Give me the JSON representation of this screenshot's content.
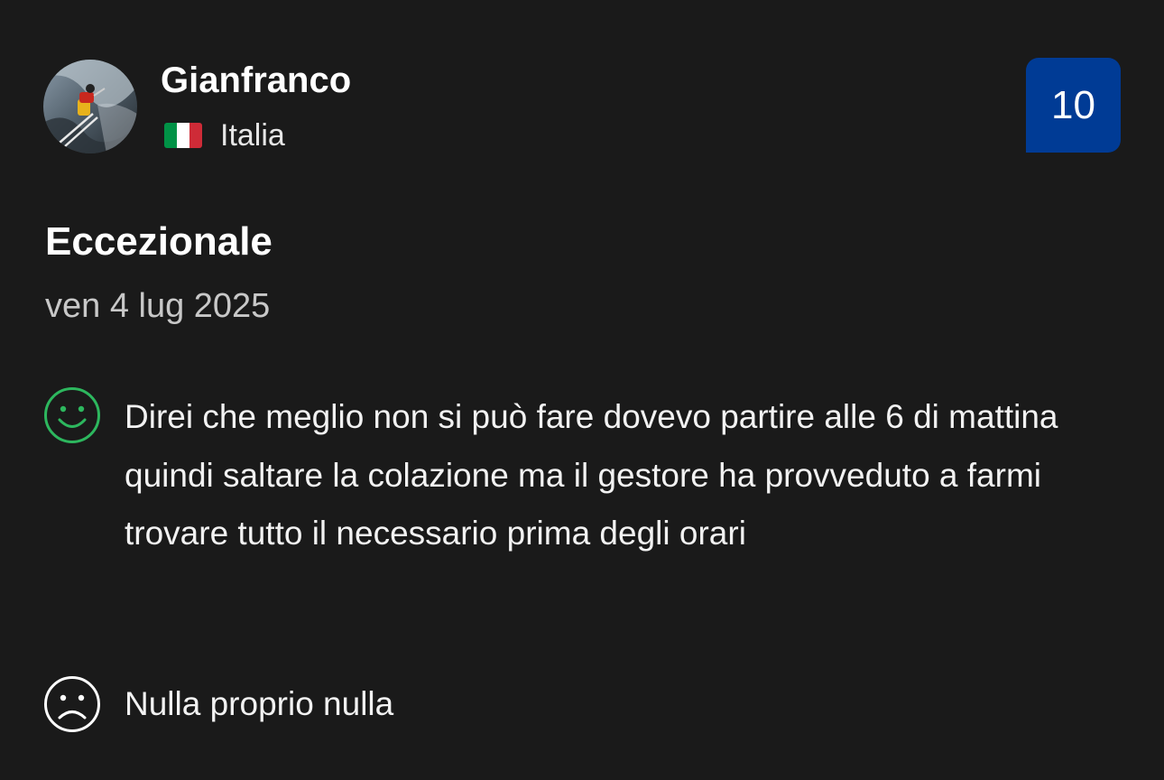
{
  "reviewer": {
    "name": "Gianfranco",
    "country": "Italia",
    "flag_icon": "italy-flag-icon",
    "avatar_icon": "skier-avatar-photo"
  },
  "score": "10",
  "review": {
    "title": "Eccezionale",
    "date": "ven 4 lug 2025",
    "positive": {
      "icon": "smile-face-icon",
      "text": "Direi che meglio non si può fare dovevo partire alle 6 di mattina quindi saltare la colazione ma il gestore ha provveduto a farmi trovare tutto il necessario prima degli orari"
    },
    "negative": {
      "icon": "sad-face-icon",
      "text": "Nulla proprio nulla"
    }
  },
  "colors": {
    "background": "#1a1a1a",
    "score_badge": "#003b95",
    "positive_icon": "#2db75e",
    "negative_icon": "#ffffff",
    "date_text": "#c8c8c8",
    "flag_green": "#009246",
    "flag_white": "#ffffff",
    "flag_red": "#ce2b37"
  }
}
